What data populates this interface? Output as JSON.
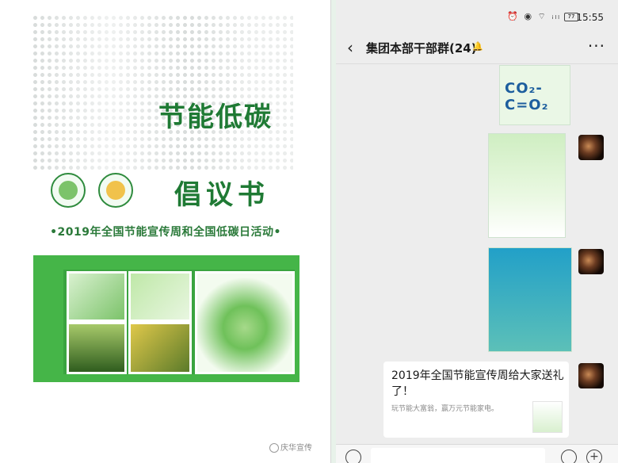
{
  "poster": {
    "title_line1": "节能低碳",
    "title_line2": "倡议书",
    "subtitle": "•2019年全国节能宣传周和全国低碳日活动•",
    "watermark": "庆华宣传"
  },
  "phone": {
    "status_time": "15:55",
    "status_icons": "⏰ ◉ ⌔ ᵢₗₗ",
    "battery": "77",
    "nav_title": "集团本部干部群(24)",
    "mute_icon": "🔔",
    "more": "···",
    "messages": [
      {
        "type": "image",
        "caption_big": "CO₂-C=O₂",
        "caption_small": "..."
      },
      {
        "type": "image"
      },
      {
        "type": "image"
      },
      {
        "type": "link_card",
        "title": "2019年全国节能宣传周给大家送礼了！",
        "desc": "玩节能大富翁，赢万元节能家电。"
      }
    ]
  },
  "colors": {
    "brand_green": "#1f7a34",
    "band_green": "#45b548",
    "chat_bg": "#ededed"
  }
}
